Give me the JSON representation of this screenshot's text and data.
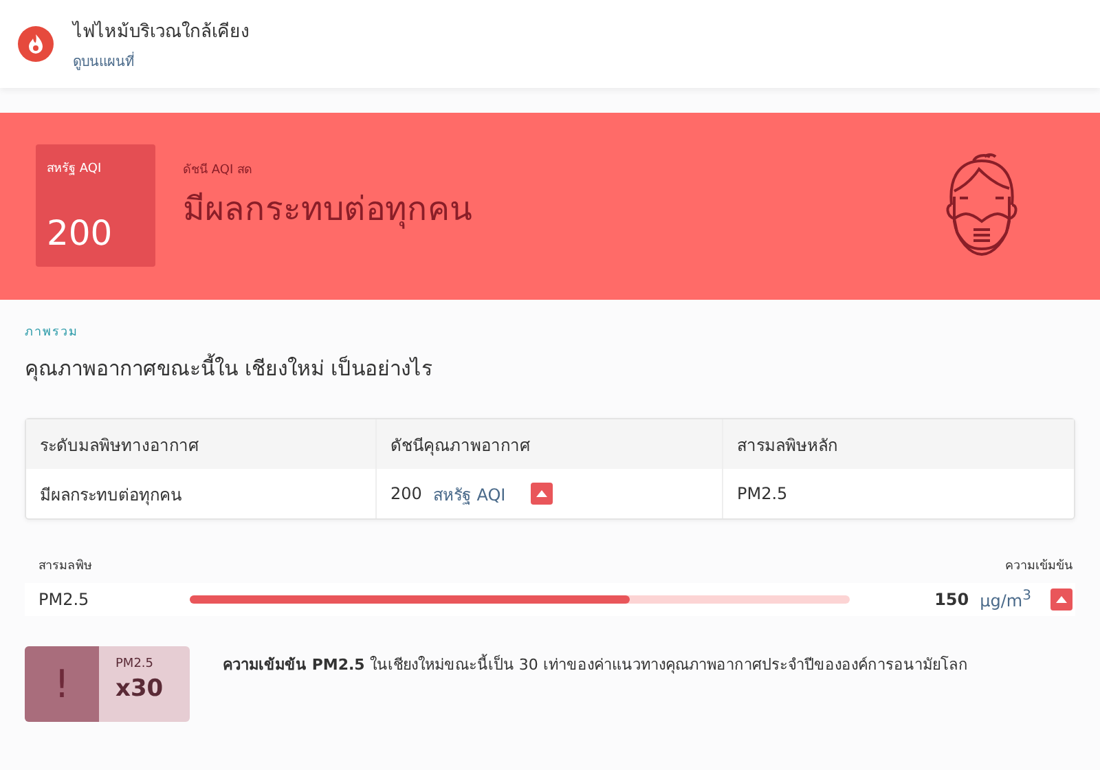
{
  "notice": {
    "title": "ไฟไหม้บริเวณใกล้เคียง",
    "link": "ดูบนแผนที่"
  },
  "hero": {
    "badge_label": "สหรัฐ AQI",
    "aqi": "200",
    "caption": "ดัชนี AQI สด",
    "status": "มีผลกระทบต่อทุกคน"
  },
  "overview": {
    "eyebrow": "ภาพรวม",
    "heading": "คุณภาพอากาศขณะนี้ใน เชียงใหม่ เป็นอย่างไร"
  },
  "table": {
    "columns": [
      "ระดับมลพิษทางอากาศ",
      "ดัชนีคุณภาพอากาศ",
      "สารมลพิษหลัก"
    ],
    "rows": [
      {
        "level": "มีผลกระทบต่อทุกคน",
        "aqi": "200",
        "unit": "สหรัฐ AQI",
        "pollutant": "PM2.5"
      }
    ]
  },
  "pollutants": {
    "label": "สารมลพิษ",
    "value_label": "ความเข้มข้น",
    "items": [
      {
        "name": "PM2.5",
        "level": 0.667,
        "value": "150",
        "unit": "µg/m$^{3}$"
      }
    ]
  },
  "alert": {
    "symbol": "!",
    "pollutant": "PM2.5",
    "multiple": "x30",
    "text": "**ความเข้มข้น PM2.5** ในเชียงใหม่ขณะนี้เป็น 30 เท่าของค่าแนวทางคุณภาพอากาศประจำปีขององค์การอนามัยโลก"
  }
}
